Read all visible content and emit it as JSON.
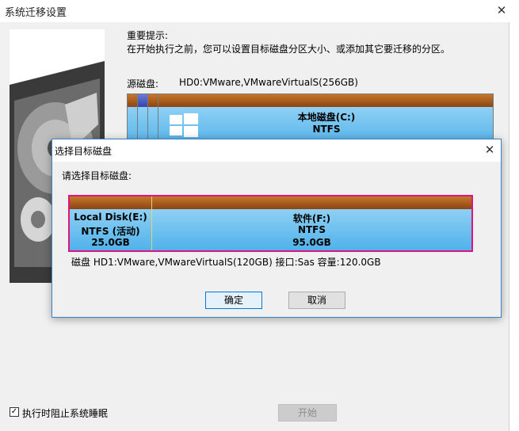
{
  "main_window": {
    "title": "系统迁移设置",
    "close_glyph": "✕"
  },
  "tips": {
    "title": "重要提示:",
    "text": "在开始执行之前，您可以设置目标磁盘分区大小、或添加其它要迁移的分区。"
  },
  "source": {
    "label": "源磁盘:",
    "name": "HD0:VMware,VMwareVirtualS(256GB)",
    "partition_label": "本地磁盘(C:)",
    "partition_fs": "NTFS"
  },
  "dialog": {
    "title": "选择目标磁盘",
    "close_glyph": "✕",
    "prompt": "请选择目标磁盘:",
    "partitions": [
      {
        "name": "Local Disk(E:)",
        "fs": "NTFS (活动)",
        "size": "25.0GB"
      },
      {
        "name": "软件(F:)",
        "fs": "NTFS",
        "size": "95.0GB"
      }
    ],
    "disk_info": "磁盘 HD1:VMware,VMwareVirtualS(120GB)  接口:Sas  容量:120.0GB",
    "ok_label": "确定",
    "cancel_label": "取消"
  },
  "footer": {
    "checkbox_checked": true,
    "checkbox_glyph": "✓",
    "checkbox_label": "执行时阻止系统睡眠",
    "start_label": "开始"
  },
  "colors": {
    "partition_cap": "#8b4513",
    "partition_body": "#4fb2ea",
    "selection_border": "#e0147f",
    "dialog_border": "#3b83c4"
  }
}
